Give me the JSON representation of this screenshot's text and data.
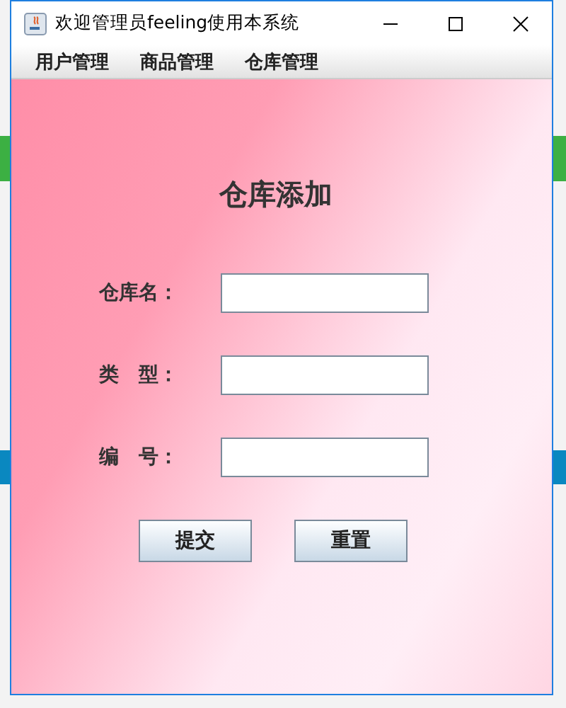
{
  "window": {
    "title": "欢迎管理员feeling使用本系统"
  },
  "menu": [
    {
      "label": "用户管理"
    },
    {
      "label": "商品管理"
    },
    {
      "label": "仓库管理"
    }
  ],
  "form": {
    "title": "仓库添加",
    "fields": [
      {
        "label": "仓库名："
      },
      {
        "label": "类　型："
      },
      {
        "label": "编　号："
      }
    ],
    "buttons": [
      {
        "label": "提交"
      },
      {
        "label": "重置"
      }
    ]
  }
}
